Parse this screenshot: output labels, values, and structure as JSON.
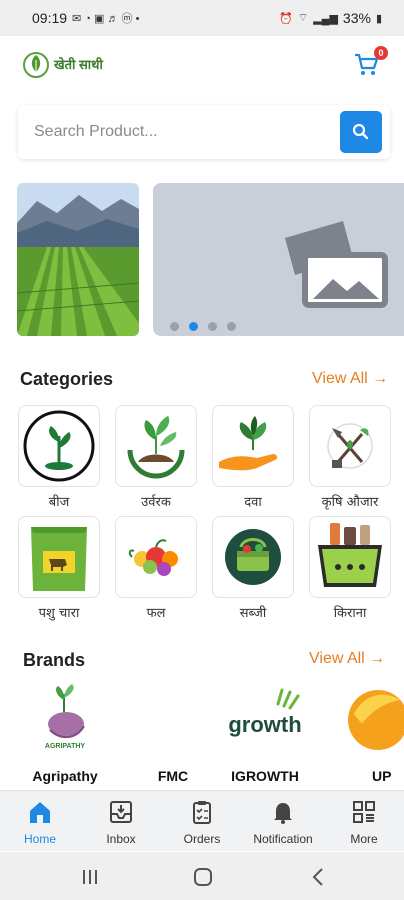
{
  "status_bar": {
    "time": "09:19",
    "battery": "33%"
  },
  "header": {
    "logo_text": "खेती साथी",
    "cart_count": "0"
  },
  "search": {
    "placeholder": "Search Product..."
  },
  "banner": {
    "active_dot": 1,
    "dot_count": 4
  },
  "categories": {
    "title": "Categories",
    "view_all": "View All",
    "items": [
      {
        "label": "बीज",
        "icon": "seed-icon"
      },
      {
        "label": "उर्वरक",
        "icon": "fertilizer-icon"
      },
      {
        "label": "दवा",
        "icon": "medicine-icon"
      },
      {
        "label": "कृषि औजार",
        "icon": "farm-tools-icon"
      },
      {
        "label": "पशु चारा",
        "icon": "cattle-feed-icon"
      },
      {
        "label": "फल",
        "icon": "fruit-icon"
      },
      {
        "label": "सब्जी",
        "icon": "vegetable-icon"
      },
      {
        "label": "किराना",
        "icon": "grocery-icon"
      }
    ]
  },
  "brands": {
    "title": "Brands",
    "view_all": "View All",
    "items": [
      {
        "name": "Agripathy",
        "logo_text": "AGRIPATHY"
      },
      {
        "name": "FMC",
        "logo_text": ""
      },
      {
        "name": "IGROWTH",
        "logo_text": "growth"
      },
      {
        "name": "UP",
        "logo_text": ""
      }
    ]
  },
  "bottom_nav": {
    "items": [
      {
        "label": "Home",
        "icon": "home-icon",
        "active": true
      },
      {
        "label": "Inbox",
        "icon": "inbox-icon",
        "active": false
      },
      {
        "label": "Orders",
        "icon": "orders-icon",
        "active": false
      },
      {
        "label": "Notification",
        "icon": "bell-icon",
        "active": false
      },
      {
        "label": "More",
        "icon": "grid-icon",
        "active": false
      }
    ]
  },
  "colors": {
    "accent": "#1e88e5",
    "view_all": "#e67e22",
    "badge": "#e53935",
    "brand_green": "#3a7d2c"
  }
}
